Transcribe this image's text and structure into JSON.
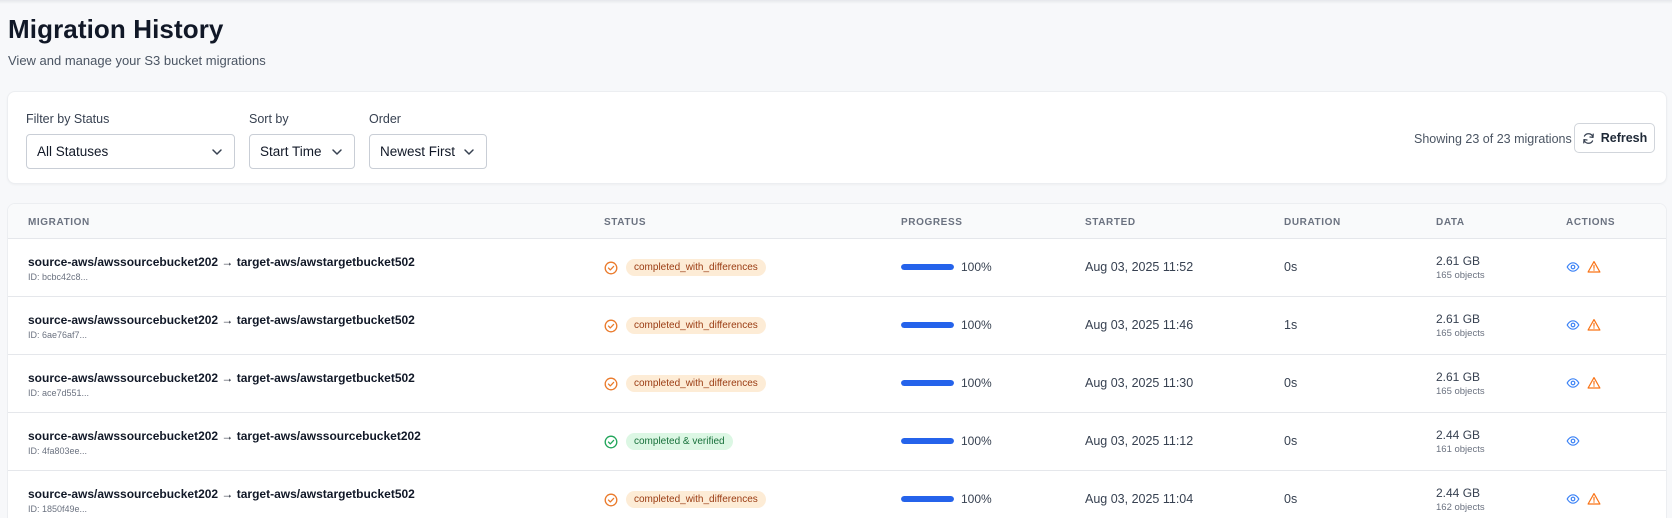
{
  "header": {
    "title": "Migration History",
    "subtitle": "View and manage your S3 bucket migrations"
  },
  "filters": {
    "status_label": "Filter by Status",
    "status_value": "All Statuses",
    "sort_label": "Sort by",
    "sort_value": "Start Time",
    "order_label": "Order",
    "order_value": "Newest First",
    "showing_text": "Showing 23 of 23 migrations",
    "refresh_label": "Refresh"
  },
  "table": {
    "columns": [
      "MIGRATION",
      "STATUS",
      "PROGRESS",
      "STARTED",
      "DURATION",
      "DATA",
      "ACTIONS"
    ],
    "rows": [
      {
        "name": "source-aws/awssourcebucket202 → target-aws/awstargetbucket502",
        "id": "ID: bcbc42c8...",
        "status": "completed_with_differences",
        "status_kind": "diff",
        "progress": 100,
        "progress_label": "100%",
        "started": "Aug 03, 2025 11:52",
        "duration": "0s",
        "data_size": "2.61 GB",
        "data_objects": "165 objects",
        "actions": [
          "eye-icon",
          "warning-icon"
        ]
      },
      {
        "name": "source-aws/awssourcebucket202 → target-aws/awstargetbucket502",
        "id": "ID: 6ae76af7...",
        "status": "completed_with_differences",
        "status_kind": "diff",
        "progress": 100,
        "progress_label": "100%",
        "started": "Aug 03, 2025 11:46",
        "duration": "1s",
        "data_size": "2.61 GB",
        "data_objects": "165 objects",
        "actions": [
          "eye-icon",
          "warning-icon"
        ]
      },
      {
        "name": "source-aws/awssourcebucket202 → target-aws/awstargetbucket502",
        "id": "ID: ace7d551...",
        "status": "completed_with_differences",
        "status_kind": "diff",
        "progress": 100,
        "progress_label": "100%",
        "started": "Aug 03, 2025 11:30",
        "duration": "0s",
        "data_size": "2.61 GB",
        "data_objects": "165 objects",
        "actions": [
          "eye-icon",
          "warning-icon"
        ]
      },
      {
        "name": "source-aws/awssourcebucket202 → target-aws/awssourcebucket202",
        "id": "ID: 4fa803ee...",
        "status": "completed & verified",
        "status_kind": "ok",
        "progress": 100,
        "progress_label": "100%",
        "started": "Aug 03, 2025 11:12",
        "duration": "0s",
        "data_size": "2.44 GB",
        "data_objects": "161 objects",
        "actions": [
          "eye-icon"
        ]
      },
      {
        "name": "source-aws/awssourcebucket202 → target-aws/awstargetbucket502",
        "id": "ID: 1850f49e...",
        "status": "completed_with_differences",
        "status_kind": "diff",
        "progress": 100,
        "progress_label": "100%",
        "started": "Aug 03, 2025 11:04",
        "duration": "0s",
        "data_size": "2.44 GB",
        "data_objects": "162 objects",
        "actions": [
          "eye-icon",
          "warning-icon"
        ]
      }
    ]
  },
  "colors": {
    "accent": "#2563eb",
    "diff_icon": "#ea7a2b",
    "ok_icon": "#22a55a",
    "eye_icon": "#3b82f6",
    "warning_icon": "#f97316"
  }
}
